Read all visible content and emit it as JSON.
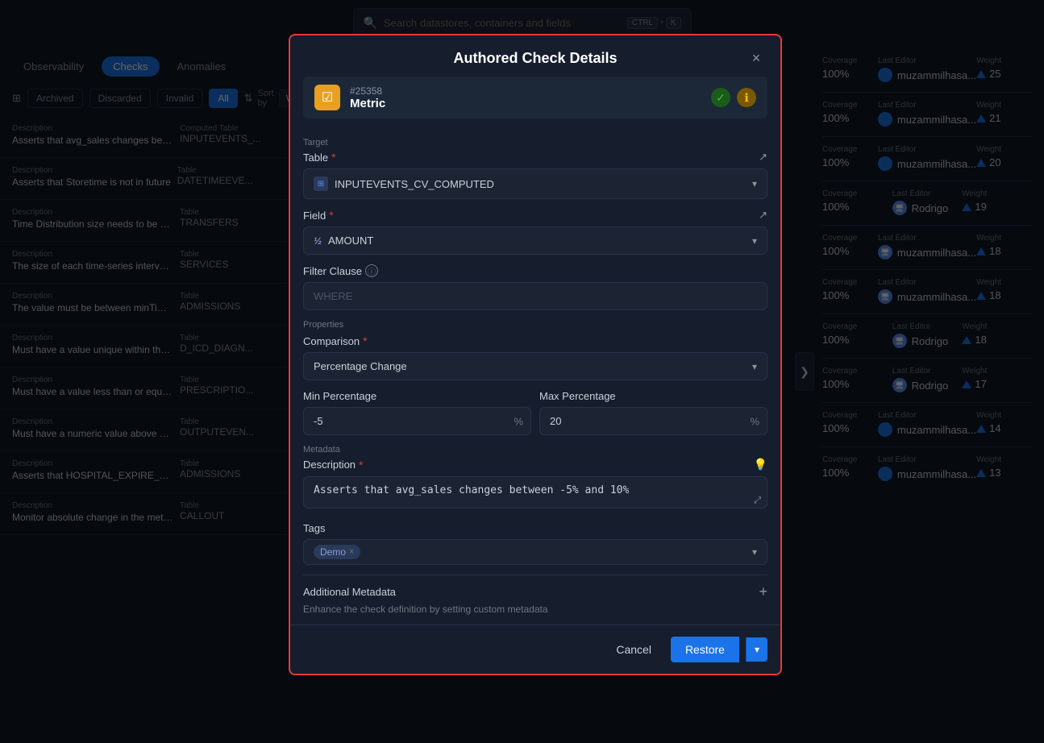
{
  "app": {
    "title": "Authored Check Details"
  },
  "search": {
    "placeholder": "Search datastores, containers and fields",
    "shortcut_ctrl": "CTRL",
    "shortcut_plus": "+",
    "shortcut_k": "K"
  },
  "nav": {
    "tabs": [
      {
        "label": "Observability",
        "active": false
      },
      {
        "label": "Checks",
        "active": true
      },
      {
        "label": "Anomalies",
        "active": false
      }
    ],
    "filters": [
      {
        "label": "Archived",
        "active": false
      },
      {
        "label": "Discarded",
        "active": false
      },
      {
        "label": "Invalid",
        "active": false
      },
      {
        "label": "All",
        "active": true
      }
    ],
    "sort_by_label": "Sort by",
    "sort_value": "Weight"
  },
  "list_items": [
    {
      "desc_label": "Description",
      "desc": "Asserts that avg_sales changes between -5% ...",
      "table_label": "Computed Table",
      "table": "INPUTEVENTS_..."
    },
    {
      "desc_label": "Description",
      "desc": "Asserts that Storetime is not in future",
      "table_label": "Table",
      "table": "DATETIMEEVE..."
    },
    {
      "desc_label": "Description",
      "desc": "Time Distribution size needs to be between 20...",
      "table_label": "Table",
      "table": "TRANSFERS"
    },
    {
      "desc_label": "Description",
      "desc": "The size of each time-series interval must be b...",
      "table_label": "Table",
      "table": "SERVICES"
    },
    {
      "desc_label": "Description",
      "desc": "The value must be between minTime and max...",
      "table_label": "Table",
      "table": "ADMISSIONS"
    },
    {
      "desc_label": "Description",
      "desc": "Must have a value unique within the observed ...",
      "table_label": "Table",
      "table": "D_ICD_DIAGN..."
    },
    {
      "desc_label": "Description",
      "desc": "Must have a value less than or equal to the val...",
      "table_label": "Table",
      "table": "PRESCRIPTIO..."
    },
    {
      "desc_label": "Description",
      "desc": "Must have a numeric value above >= 0",
      "table_label": "Table",
      "table": "OUTPUTEVEN..."
    },
    {
      "desc_label": "Description",
      "desc": "Asserts that HOSPITAL_EXPIRE_FLAG is 0 or 1",
      "table_label": "Table",
      "table": "ADMISSIONS"
    },
    {
      "desc_label": "Description",
      "desc": "Monitor absolute change in the metric value w...",
      "table_label": "Table",
      "table": "CALLOUT"
    }
  ],
  "right_panel": {
    "rows": [
      {
        "coverage_label": "Coverage",
        "coverage_val": "100%",
        "editor_label": "Last Editor",
        "editor_val": "muzammilhasa...",
        "weight_label": "Weight",
        "weight_val": "25"
      },
      {
        "coverage_label": "Coverage",
        "coverage_val": "100%",
        "editor_label": "Last Editor",
        "editor_val": "muzammilhasa...",
        "weight_label": "Weight",
        "weight_val": "21"
      },
      {
        "coverage_label": "Coverage",
        "coverage_val": "100%",
        "editor_label": "Last Editor",
        "editor_val": "muzammilhasa...",
        "weight_label": "Weight",
        "weight_val": "20"
      },
      {
        "coverage_label": "Coverage",
        "coverage_val": "100%",
        "editor_label": "Last Editor",
        "editor_val": "Rodrigo",
        "weight_label": "Weight",
        "weight_val": "19"
      },
      {
        "coverage_label": "Coverage",
        "coverage_val": "100%",
        "editor_label": "Last Editor",
        "editor_val": "muzammilhasa...",
        "weight_label": "Weight",
        "weight_val": "18"
      },
      {
        "coverage_label": "Coverage",
        "coverage_val": "100%",
        "editor_label": "Last Editor",
        "editor_val": "muzammilhasa...",
        "weight_label": "Weight",
        "weight_val": "18"
      },
      {
        "coverage_label": "Coverage",
        "coverage_val": "100%",
        "editor_label": "Last Editor",
        "editor_val": "Rodrigo",
        "weight_label": "Weight",
        "weight_val": "18"
      },
      {
        "coverage_label": "Coverage",
        "coverage_val": "100%",
        "editor_label": "Last Editor",
        "editor_val": "Rodrigo",
        "weight_label": "Weight",
        "weight_val": "17"
      },
      {
        "coverage_label": "Coverage",
        "coverage_val": "100%",
        "editor_label": "Last Editor",
        "editor_val": "muzammilhasa...",
        "weight_label": "Weight",
        "weight_val": "14"
      },
      {
        "coverage_label": "Coverage",
        "coverage_val": "100%",
        "editor_label": "Last Editor",
        "editor_val": "muzammilhasa...",
        "weight_label": "Weight",
        "weight_val": "13"
      }
    ]
  },
  "modal": {
    "title": "Authored Check Details",
    "close_label": "×",
    "check_id": "#25358",
    "check_type": "Metric",
    "target_label": "Target",
    "table_label": "Table",
    "table_required": true,
    "table_value": "INPUTEVENTS_CV_COMPUTED",
    "field_label": "Field",
    "field_required": true,
    "field_value": "AMOUNT",
    "filter_clause_label": "Filter Clause",
    "filter_placeholder": "WHERE",
    "properties_label": "Properties",
    "comparison_label": "Comparison",
    "comparison_required": true,
    "comparison_value": "Percentage Change",
    "min_percentage_label": "Min Percentage",
    "min_percentage_value": "-5",
    "max_percentage_label": "Max Percentage",
    "max_percentage_value": "20",
    "metadata_label": "Metadata",
    "description_label": "Description",
    "description_required": true,
    "description_value": "Asserts that avg_sales changes between -5% and 10%",
    "tags_label": "Tags",
    "tags": [
      {
        "label": "Demo"
      }
    ],
    "additional_meta_title": "Additional Metadata",
    "additional_meta_desc": "Enhance the check definition by setting custom metadata",
    "cancel_label": "Cancel",
    "restore_label": "Restore",
    "percentage_suffix": "%"
  },
  "toggle_icon": "❯"
}
